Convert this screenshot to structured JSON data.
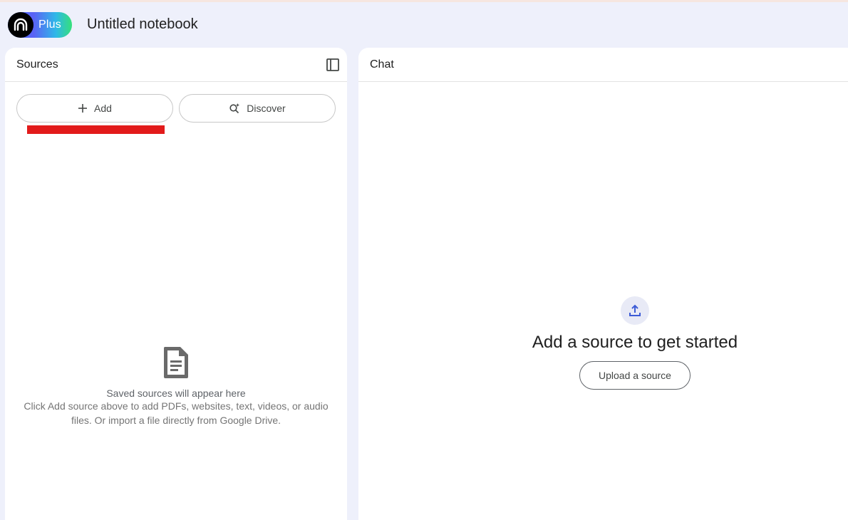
{
  "header": {
    "plan_badge": "Plus",
    "notebook_title": "Untitled notebook"
  },
  "sources_panel": {
    "title": "Sources",
    "add_label": "Add",
    "discover_label": "Discover",
    "empty_title": "Saved sources will appear here",
    "empty_desc": "Click Add source above to add PDFs, websites, text, videos, or audio files. Or import a file directly from Google Drive."
  },
  "chat_panel": {
    "title": "Chat",
    "heading": "Add a source to get started",
    "upload_label": "Upload a source"
  },
  "icons": {
    "logo": "notebooklm-logo-icon",
    "collapse": "panel-collapse-icon",
    "add": "plus-icon",
    "discover": "search-sparkle-icon",
    "document": "document-icon",
    "upload": "upload-icon"
  },
  "colors": {
    "background": "#eef0fb",
    "panel": "#ffffff",
    "annotation_mark": "#e21b1b",
    "upload_accent": "#3c5bd6"
  }
}
